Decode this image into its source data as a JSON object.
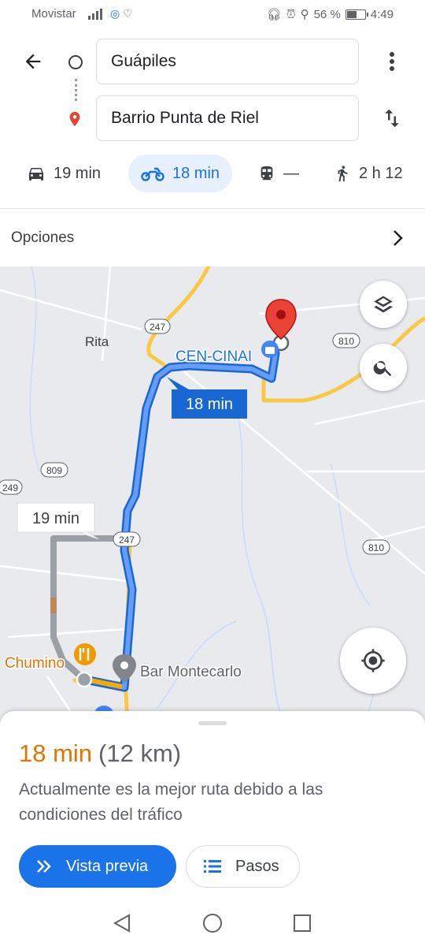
{
  "status_bar": {
    "carrier": "Movistar",
    "battery_percent": "56 %",
    "battery_level": 0.56,
    "time": "4:49"
  },
  "route": {
    "origin": "Guápiles",
    "destination": "Barrio Punta de Riel"
  },
  "modes": [
    {
      "icon": "car-icon",
      "label": "19 min",
      "active": false
    },
    {
      "icon": "motorcycle-icon",
      "label": "18 min",
      "active": true
    },
    {
      "icon": "transit-icon",
      "label": "—",
      "active": false
    },
    {
      "icon": "walk-icon",
      "label": "2 h 12",
      "active": false
    }
  ],
  "options_label": "Opciones",
  "map": {
    "place_labels": {
      "rita": "Rita",
      "cen_cinai": "CEN-CINAI",
      "chumino": "Chumino",
      "bar_montecarlo": "Bar Montecarlo"
    },
    "road_shields": {
      "r247_north": "247",
      "r810_east": "810",
      "r809": "809",
      "r249": "249",
      "r247_south": "247",
      "r810_south": "810"
    },
    "route_bubbles": {
      "primary": "18 min",
      "alternate": "19 min"
    },
    "colors": {
      "primary_route": "#4285f4",
      "alternate_route": "#9aa0a6",
      "destination_pin": "#ea4335",
      "highway": "#f9c845"
    }
  },
  "sheet": {
    "eta": "18 min",
    "distance": "(12 km)",
    "description": "Actualmente es la mejor ruta debido a las condiciones del tráfico",
    "preview_button": "Vista previa",
    "steps_button": "Pasos"
  },
  "accent_color": "#1a73e8"
}
